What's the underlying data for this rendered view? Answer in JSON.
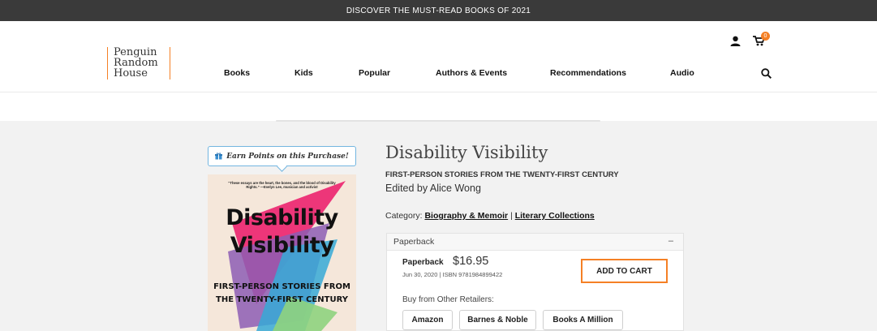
{
  "promo_bar": {
    "text": "DISCOVER THE MUST-READ BOOKS OF 2021"
  },
  "logo": {
    "lines": [
      "Penguin",
      "Random",
      "House"
    ]
  },
  "nav": {
    "items": [
      "Books",
      "Kids",
      "Popular",
      "Authors & Events",
      "Recommendations",
      "Audio"
    ]
  },
  "header_icons": {
    "account": "user-icon",
    "cart": "cart-icon",
    "cart_count": "0",
    "search": "search-icon"
  },
  "earn_points": {
    "text": "Earn Points on this Purchase!",
    "icon": "gift-icon"
  },
  "cover": {
    "quote": "“These essays are the heart, the bones, and the blood of Disability Rights.” —Evelyn Lee, musician and activist",
    "title_line1": "Disability",
    "title_line2": "Visibility",
    "subtitle_line1": "FIRST-PERSON STORIES FROM",
    "subtitle_line2": "THE TWENTY-FIRST CENTURY"
  },
  "book": {
    "title": "Disability Visibility",
    "subtitle": "FIRST-PERSON STORIES FROM THE TWENTY-FIRST CENTURY",
    "editor": "Edited by Alice Wong",
    "category_label": "Category:",
    "categories": [
      "Biography & Memoir",
      "Literary Collections"
    ],
    "category_sep": "|"
  },
  "format": {
    "header": "Paperback",
    "toggle": "–",
    "name": "Paperback",
    "price": "$16.95",
    "meta": "Jun 30, 2020 | ISBN 9781984899422",
    "add_to_cart": "ADD TO CART",
    "other_retailers_label": "Buy from Other Retailers:",
    "retailers": [
      "Amazon",
      "Barnes & Noble",
      "Books A Million"
    ]
  },
  "colors": {
    "accent": "#f58025",
    "topbar": "#3a3a3a",
    "earn_border": "#73b6e0"
  }
}
